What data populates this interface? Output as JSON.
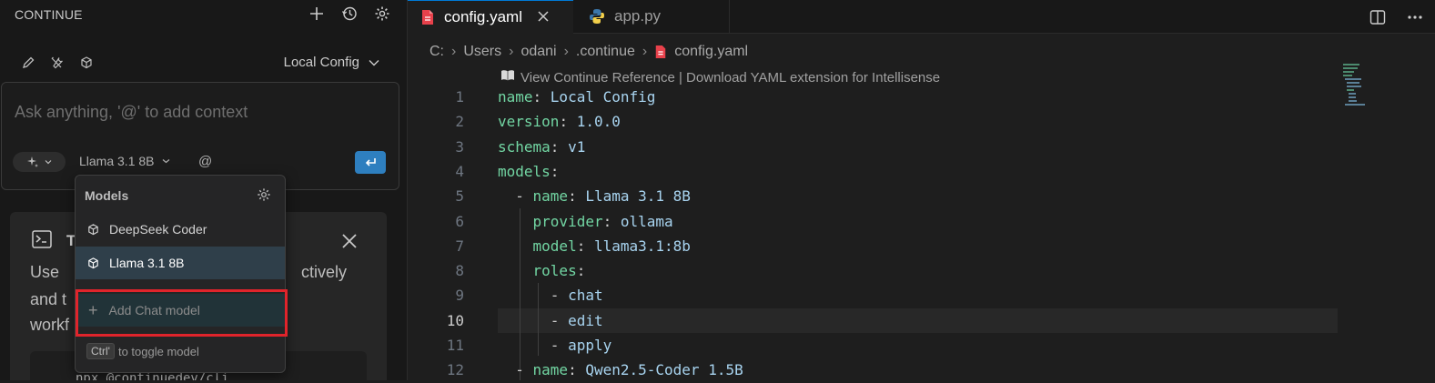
{
  "left_panel": {
    "title": "CONTINUE",
    "config_selector": "Local Config",
    "input_placeholder": "Ask anything, '@' to add context",
    "current_model": "Llama 3.1 8B",
    "at_symbol": "@",
    "card": {
      "title_visible": "T",
      "line1_start": "Use",
      "line1_end": "ctively",
      "line2_start": "and t",
      "line3_start": "workf",
      "code_text": "npx @continuedev/cli"
    }
  },
  "models_popup": {
    "header": "Models",
    "items": [
      {
        "label": "DeepSeek Coder",
        "selected": false
      },
      {
        "label": "Llama 3.1 8B",
        "selected": true
      }
    ],
    "add_label": "Add Chat model",
    "hint_key": "Ctrl'",
    "hint_text": "to toggle model"
  },
  "editor": {
    "tabs": [
      {
        "label": "config.yaml",
        "active": true
      },
      {
        "label": "app.py",
        "active": false
      }
    ],
    "breadcrumb": [
      "C:",
      "Users",
      "odani",
      ".continue",
      "config.yaml"
    ],
    "codelens": "View Continue Reference | Download YAML extension for Intellisense",
    "current_line": 10,
    "lines": [
      {
        "n": "1",
        "indent": "",
        "key": "name",
        "value": "Local Config"
      },
      {
        "n": "2",
        "indent": "",
        "key": "version",
        "value": "1.0.0"
      },
      {
        "n": "3",
        "indent": "",
        "key": "schema",
        "value": "v1"
      },
      {
        "n": "4",
        "indent": "",
        "key": "models",
        "value": ""
      },
      {
        "n": "5",
        "indent": "  - ",
        "key": "name",
        "value": "Llama 3.1 8B"
      },
      {
        "n": "6",
        "indent": "    ",
        "key": "provider",
        "value": "ollama"
      },
      {
        "n": "7",
        "indent": "    ",
        "key": "model",
        "value": "llama3.1:8b"
      },
      {
        "n": "8",
        "indent": "    ",
        "key": "roles",
        "value": ""
      },
      {
        "n": "9",
        "indent": "      - ",
        "key": "",
        "value": "chat"
      },
      {
        "n": "10",
        "indent": "      - ",
        "key": "",
        "value": "edit"
      },
      {
        "n": "11",
        "indent": "      - ",
        "key": "",
        "value": "apply"
      },
      {
        "n": "12",
        "indent": "  - ",
        "key": "name",
        "value": "Qwen2.5-Coder 1.5B"
      }
    ]
  },
  "colors": {
    "accent": "#0078d4",
    "send_button": "#2e7fbf",
    "highlight_border": "#e0242b",
    "yaml_key": "#72d6a3",
    "yaml_value": "#a8d4f0"
  }
}
